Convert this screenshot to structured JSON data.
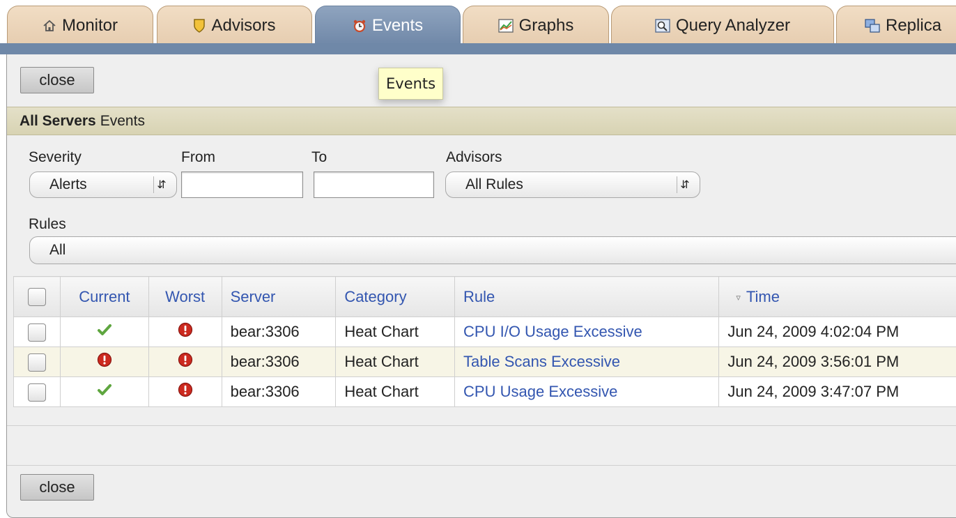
{
  "tabs": [
    {
      "label": "Monitor",
      "icon": "house-icon"
    },
    {
      "label": "Advisors",
      "icon": "shield-icon"
    },
    {
      "label": "Events",
      "icon": "alarm-clock-icon"
    },
    {
      "label": "Graphs",
      "icon": "graph-icon"
    },
    {
      "label": "Query Analyzer",
      "icon": "magnifier-icon"
    },
    {
      "label": "Replica",
      "icon": "replication-icon"
    }
  ],
  "active_tab": "Events",
  "tooltip": "Events",
  "buttons": {
    "close_top": "close",
    "close_bottom": "close"
  },
  "section": {
    "bold": "All Servers",
    "rest": "Events"
  },
  "filters": {
    "severity": {
      "label": "Severity",
      "value": "Alerts"
    },
    "from": {
      "label": "From",
      "value": ""
    },
    "to": {
      "label": "To",
      "value": ""
    },
    "advisors": {
      "label": "Advisors",
      "value": "All Rules"
    },
    "rules": {
      "label": "Rules",
      "value": "All"
    }
  },
  "table": {
    "headers": {
      "current": "Current",
      "worst": "Worst",
      "server": "Server",
      "category": "Category",
      "rule": "Rule",
      "time": "Time"
    },
    "rows": [
      {
        "current": "ok",
        "worst": "alert",
        "server": "bear:3306",
        "category": "Heat Chart",
        "rule": "CPU I/O Usage Excessive",
        "time": "Jun 24, 2009 4:02:04 PM"
      },
      {
        "current": "alert",
        "worst": "alert",
        "server": "bear:3306",
        "category": "Heat Chart",
        "rule": "Table Scans Excessive",
        "time": "Jun 24, 2009 3:56:01 PM"
      },
      {
        "current": "ok",
        "worst": "alert",
        "server": "bear:3306",
        "category": "Heat Chart",
        "rule": "CPU Usage Excessive",
        "time": "Jun 24, 2009 3:47:07 PM"
      }
    ]
  },
  "colors": {
    "active_tab": "#7088a8",
    "link": "#3356b0",
    "ok": "#5fa640",
    "alert": "#cc2a1f"
  }
}
